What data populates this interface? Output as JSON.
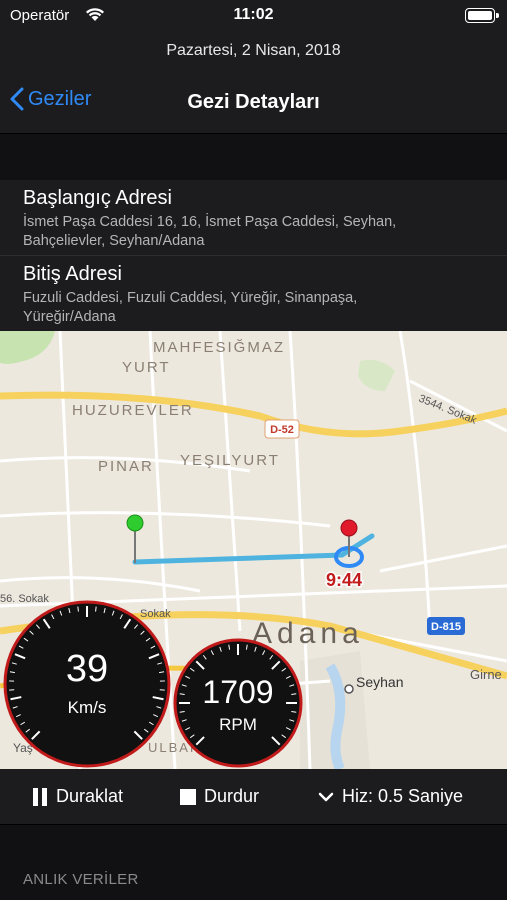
{
  "status": {
    "carrier": "Operatör",
    "time": "11:02"
  },
  "nav": {
    "date": "Pazartesi, 2 Nisan, 2018",
    "back_label": "Geziler",
    "title": "Gezi Detayları"
  },
  "start": {
    "title": "Başlangıç Adresi",
    "line1": "İsmet Paşa Caddesi 16, 16, İsmet Paşa Caddesi, Seyhan,",
    "line2": "Bahçelievler, Seyhan/Adana"
  },
  "end": {
    "title": "Bitiş Adresi",
    "line1": "Fuzuli Caddesi, Fuzuli Caddesi, Yüreğir, Sinanpaşa,",
    "line2": "Yüreğir/Adana"
  },
  "map": {
    "labels": {
      "mahfesigmaz": "MAHFESIĞMAZ",
      "yurt": "YURT",
      "huzurevler": "HUZUREVLER",
      "pinar": "PINAR",
      "yesilyurt": "YEŞILYURT",
      "adana": "Adana",
      "seyhan": "Seyhan",
      "girne": "Girne",
      "sokak3544": "3544. Sokak",
      "sokak56": "56. Sokak",
      "sokak": "Sokak",
      "yas": "Yaş",
      "ulbar": "ULBAR"
    },
    "road_badges": {
      "d52": "D-52",
      "d815": "D-815"
    },
    "end_time": "9:44"
  },
  "gauges": {
    "speed": {
      "value": "39",
      "unit": "Km/s"
    },
    "rpm": {
      "value": "1709",
      "unit": "RPM"
    }
  },
  "controls": {
    "pause_label": "Duraklat",
    "stop_label": "Durdur",
    "speed_label": "Hiz: 0.5 Saniye"
  },
  "section": {
    "live_data": "ANLIK VERİLER"
  },
  "colors": {
    "accent": "#2f8af5",
    "route": "#4fb3e0",
    "start_pin": "#2ecc2e",
    "end_pin": "#e0192b"
  }
}
